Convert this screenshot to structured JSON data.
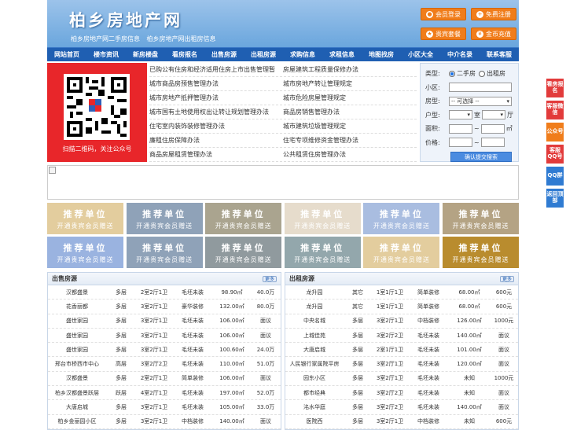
{
  "header": {
    "logo": "柏乡房地产网",
    "subtitle": "柏乡房地产网二手房信息 柏乡房地产网出租房信息",
    "buttons": [
      {
        "label": "会员登录",
        "icon": "user-icon"
      },
      {
        "label": "免费注册",
        "icon": "user-add-icon"
      },
      {
        "label": "贵宾套餐",
        "icon": "gift-icon"
      },
      {
        "label": "金币充值",
        "icon": "coin-icon"
      }
    ]
  },
  "nav": [
    "网站首页",
    "楼市资讯",
    "新房楼盘",
    "看房报名",
    "出售房源",
    "出租房源",
    "求购信息",
    "求租信息",
    "地图找房",
    "小区大全",
    "中介名录",
    "联系客服"
  ],
  "qr": {
    "caption": "扫描二维码，关注公众号"
  },
  "links": [
    [
      "已购公有住房和经济适用住房上市出售管理暂",
      "房屋建筑工程质量保修办法"
    ],
    [
      "城市商品房预售管理办法",
      "城市房地产转让管理规定"
    ],
    [
      "城市房地产抵押管理办法",
      "城市危险房屋管理规定"
    ],
    [
      "城市国有土地使用权出让转让规划管理办法",
      "商品房销售管理办法"
    ],
    [
      "住宅室内装饰装修管理办法",
      "城市建筑垃圾管理规定"
    ],
    [
      "廉租住房保障办法",
      "住宅专项维修资金管理办法"
    ],
    [
      "商品房屋租赁管理办法",
      "公共租赁住房管理办法"
    ]
  ],
  "search": {
    "type_label": "类型:",
    "type_options": [
      "二手房",
      "出租房"
    ],
    "community_label": "小区:",
    "type2_label": "房型:",
    "select_default": "-- 可选择 --",
    "layout_label": "户型:",
    "room": "室",
    "hall": "厅",
    "area_label": "面积:",
    "tilde": "~",
    "area_unit": "㎡",
    "price_label": "价格:",
    "submit": "确认提交搜索"
  },
  "ads": [
    {
      "line1": "推荐单位",
      "line2": "开通贵宾会员赠送",
      "color": "#e3cd9e"
    },
    {
      "line1": "推荐单位",
      "line2": "开通贵宾会员赠送",
      "color": "#8fa2b8"
    },
    {
      "line1": "推荐单位",
      "line2": "开通贵宾会员赠送",
      "color": "#aaa48f"
    },
    {
      "line1": "推荐单位",
      "line2": "开通贵宾会员赠送",
      "color": "#e6dccc"
    },
    {
      "line1": "推荐单位",
      "line2": "开通贵宾会员赠送",
      "color": "#a9bde0"
    },
    {
      "line1": "推荐单位",
      "line2": "开通贵宾会员赠送",
      "color": "#b4a384"
    },
    {
      "line1": "推荐单位",
      "line2": "开通贵宾会员赠送",
      "color": "#9ab3e0"
    },
    {
      "line1": "推荐单位",
      "line2": "开通贵宾会员赠送",
      "color": "#8fa2b8"
    },
    {
      "line1": "推荐单位",
      "line2": "开通贵宾会员赠送",
      "color": "#909a9e"
    },
    {
      "line1": "推荐单位",
      "line2": "开通贵宾会员赠送",
      "color": "#93a7ac"
    },
    {
      "line1": "推荐单位",
      "line2": "开通贵宾会员赠送",
      "color": "#e3cd9e"
    },
    {
      "line1": "推荐单位",
      "line2": "开通贵宾会员赠送",
      "color": "#b98c2e"
    }
  ],
  "sale": {
    "title": "出售房源",
    "more": "更多",
    "rows": [
      [
        "汉都盛景",
        "多层",
        "2室2厅1卫",
        "毛坯未装",
        "98.90㎡",
        "40.0万"
      ],
      [
        "花香丽都",
        "多层",
        "3室2厅1卫",
        "豪华装修",
        "132.00㎡",
        "80.0万"
      ],
      [
        "盛世家园",
        "多层",
        "3室2厅1卫",
        "毛坯未装",
        "106.00㎡",
        "面议"
      ],
      [
        "盛世家园",
        "多层",
        "3室2厅1卫",
        "毛坯未装",
        "106.00㎡",
        "面议"
      ],
      [
        "盛世家园",
        "多层",
        "3室2厅1卫",
        "毛坯未装",
        "100.60㎡",
        "24.0万"
      ],
      [
        "邢台市桥西市中心",
        "高层",
        "3室2厅2卫",
        "毛坯未装",
        "110.00㎡",
        "51.0万"
      ],
      [
        "汉都盛景",
        "多层",
        "2室2厅1卫",
        "简单装修",
        "106.00㎡",
        "面议"
      ],
      [
        "柏乡汉都盛景跃层",
        "跃层",
        "4室2厅1卫",
        "毛坯未装",
        "197.00㎡",
        "52.0万"
      ],
      [
        "大唐启城",
        "多层",
        "3室2厅1卫",
        "毛坯未装",
        "105.00㎡",
        "33.0万"
      ],
      [
        "柏乡金丽园小区",
        "多层",
        "3室2厅1卫",
        "中档装修",
        "140.00㎡",
        "面议"
      ]
    ]
  },
  "rent": {
    "title": "出租房源",
    "more": "更多",
    "rows": [
      [
        "龙升园",
        "其它",
        "1室1厅1卫",
        "简单装修",
        "68.00㎡",
        "600元"
      ],
      [
        "龙升园",
        "其它",
        "1室1厅1卫",
        "简单装修",
        "68.00㎡",
        "600元"
      ],
      [
        "中央名城",
        "多层",
        "3室2厅1卫",
        "中档装修",
        "126.00㎡",
        "1000元"
      ],
      [
        "上城佳苑",
        "多层",
        "3室2厅2卫",
        "毛坯未装",
        "140.00㎡",
        "面议"
      ],
      [
        "大唐启城",
        "多层",
        "2室1厅1卫",
        "毛坯未装",
        "101.00㎡",
        "面议"
      ],
      [
        "人民银行家属院平房",
        "多层",
        "3室2厅1卫",
        "毛坯未装",
        "120.00㎡",
        "面议"
      ],
      [
        "园东小区",
        "多层",
        "3室2厅1卫",
        "毛坯未装",
        "未知",
        "1000元"
      ],
      [
        "都市经典",
        "多层",
        "3室2厅2卫",
        "毛坯未装",
        "未知",
        "面议"
      ],
      [
        "洺水华庭",
        "多层",
        "3室2厅2卫",
        "毛坯未装",
        "140.00㎡",
        "面议"
      ],
      [
        "医院西",
        "多层",
        "3室2厅1卫",
        "中档装修",
        "未知",
        "600元"
      ]
    ]
  },
  "side": [
    {
      "label": "看房报名",
      "color": "#e23b3b"
    },
    {
      "label": "客服微信",
      "color": "#e23b3b"
    },
    {
      "label": "公众号",
      "color": "#f07d1b"
    },
    {
      "label": "客服QQ号",
      "color": "#e23b3b"
    },
    {
      "label": "QQ群",
      "color": "#2f7bd2"
    },
    {
      "label": "返回顶部",
      "color": "#2f7bd2"
    }
  ]
}
